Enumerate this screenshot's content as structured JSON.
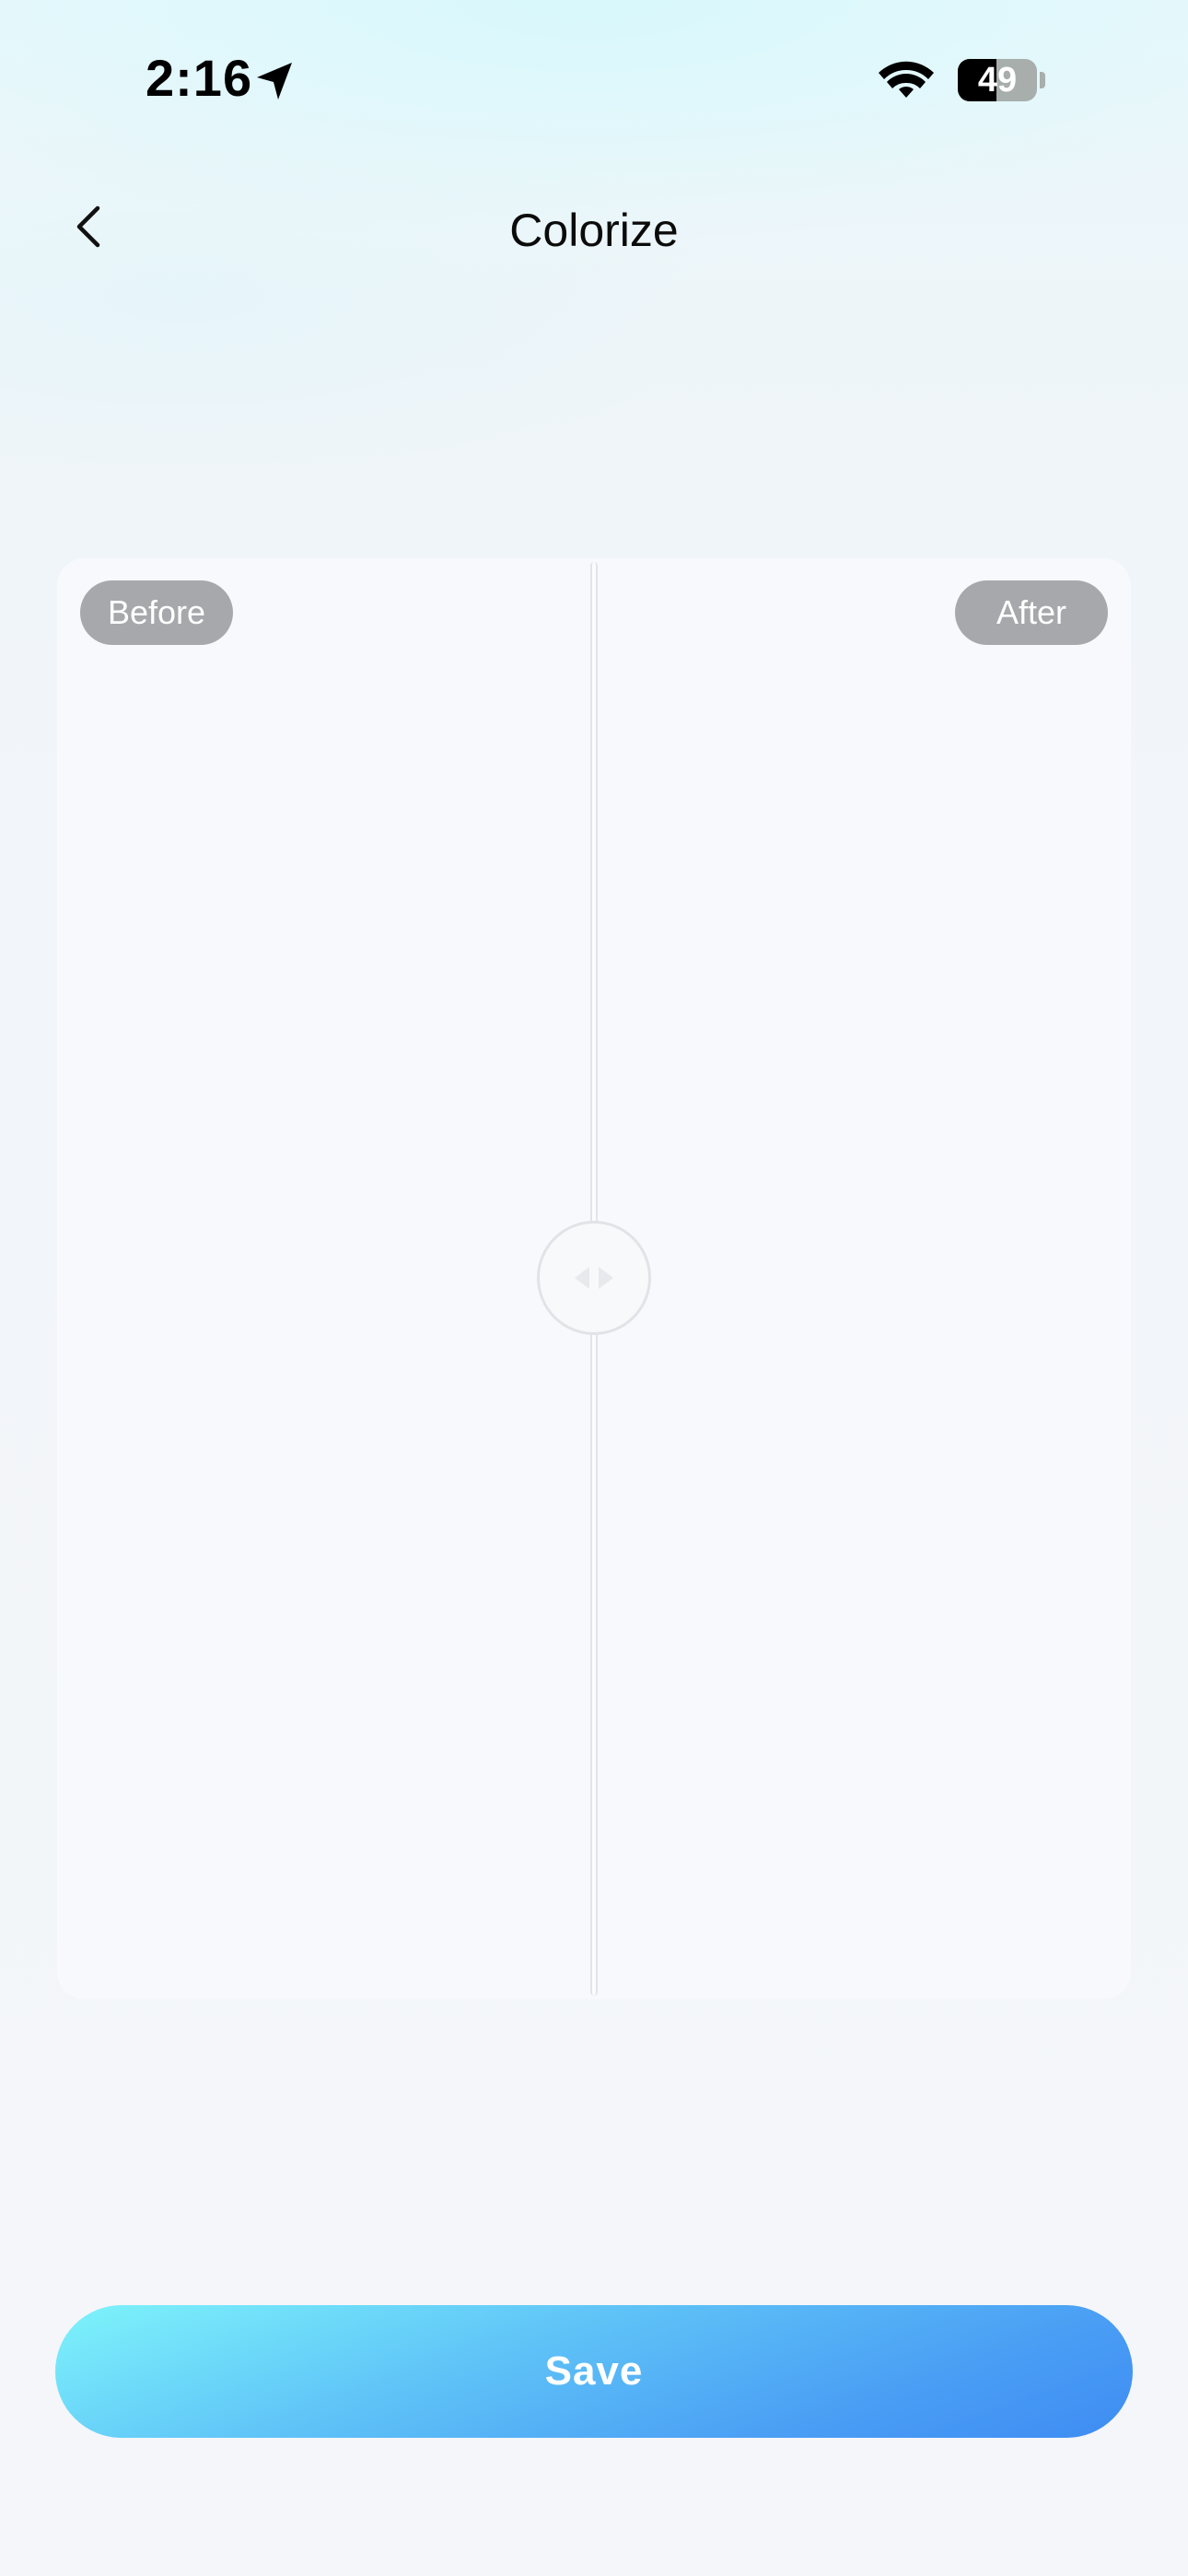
{
  "status_bar": {
    "time": "2:16",
    "battery_percent": "49",
    "battery_level": 0.49
  },
  "nav": {
    "title": "Colorize",
    "back_icon": "chevron-left-icon"
  },
  "compare": {
    "before_label": "Before",
    "after_label": "After",
    "handle_icon": "split-arrows-icon"
  },
  "actions": {
    "save_label": "Save"
  },
  "colors": {
    "accent_start": "#7ef4fb",
    "accent_end": "#3e8cf3",
    "pill_bg": "#a6a8ac"
  }
}
